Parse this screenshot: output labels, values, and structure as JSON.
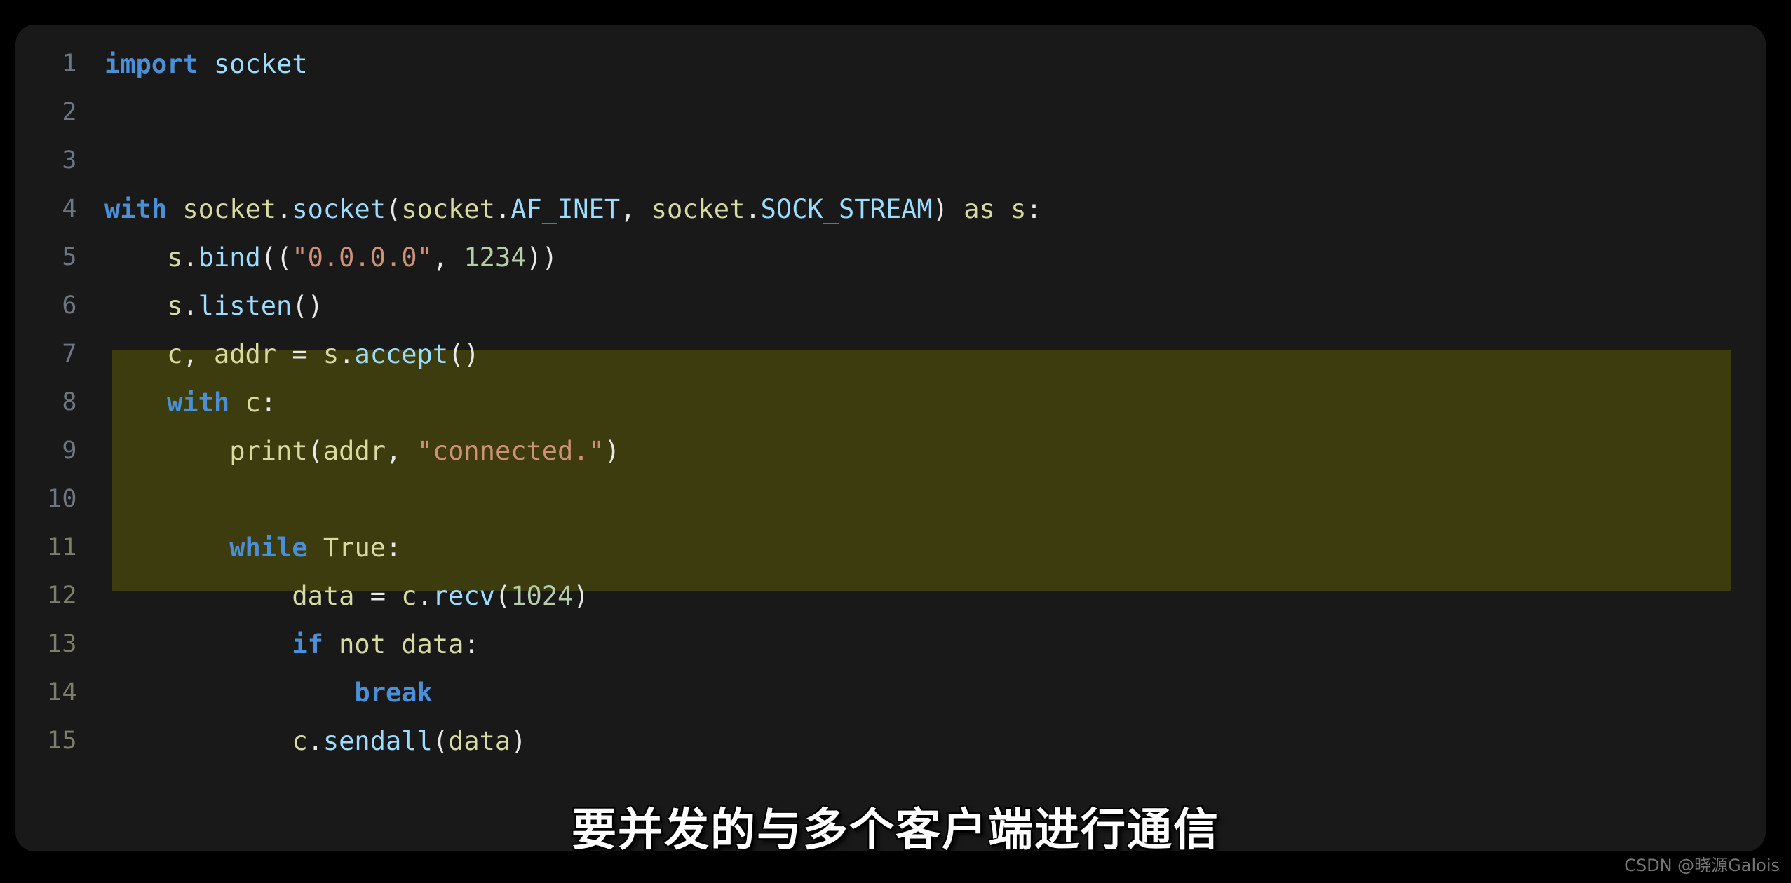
{
  "page": {
    "background_color": "#000000",
    "panel_background_color": "#19191a"
  },
  "editor": {
    "language": "python",
    "gutter_color": "#6e7681",
    "highlight_color": "#3c3c0f",
    "highlighted_lines": [
      11,
      12,
      13,
      14,
      15
    ],
    "line_numbers": [
      "1",
      "2",
      "3",
      "4",
      "5",
      "6",
      "7",
      "8",
      "9",
      "10",
      "11",
      "12",
      "13",
      "14",
      "15"
    ],
    "lines": [
      {
        "number": "1",
        "text": "import socket"
      },
      {
        "number": "2",
        "text": ""
      },
      {
        "number": "3",
        "text": ""
      },
      {
        "number": "4",
        "text": "with socket.socket(socket.AF_INET, socket.SOCK_STREAM) as s:"
      },
      {
        "number": "5",
        "text": "    s.bind((\"0.0.0.0\", 1234))"
      },
      {
        "number": "6",
        "text": "    s.listen()"
      },
      {
        "number": "7",
        "text": "    c, addr = s.accept()"
      },
      {
        "number": "8",
        "text": "    with c:"
      },
      {
        "number": "9",
        "text": "        print(addr, \"connected.\")"
      },
      {
        "number": "10",
        "text": ""
      },
      {
        "number": "11",
        "text": "        while True:"
      },
      {
        "number": "12",
        "text": "            data = c.recv(1024)"
      },
      {
        "number": "13",
        "text": "            if not data:"
      },
      {
        "number": "14",
        "text": "                break"
      },
      {
        "number": "15",
        "text": "            c.sendall(data)"
      }
    ],
    "syntax_colors": {
      "keyword": "#4b8fd6",
      "identifier": "#d7dba0",
      "attribute": "#9cdcfe",
      "string": "#ce9178",
      "number": "#b5cea8",
      "punctuation": "#e8e8e8"
    }
  },
  "subtitle": {
    "text": "要并发的与多个客户端进行通信",
    "color": "#ffffff"
  },
  "watermark": {
    "text": "CSDN @晓源Galois",
    "color": "#8a8a8a"
  }
}
